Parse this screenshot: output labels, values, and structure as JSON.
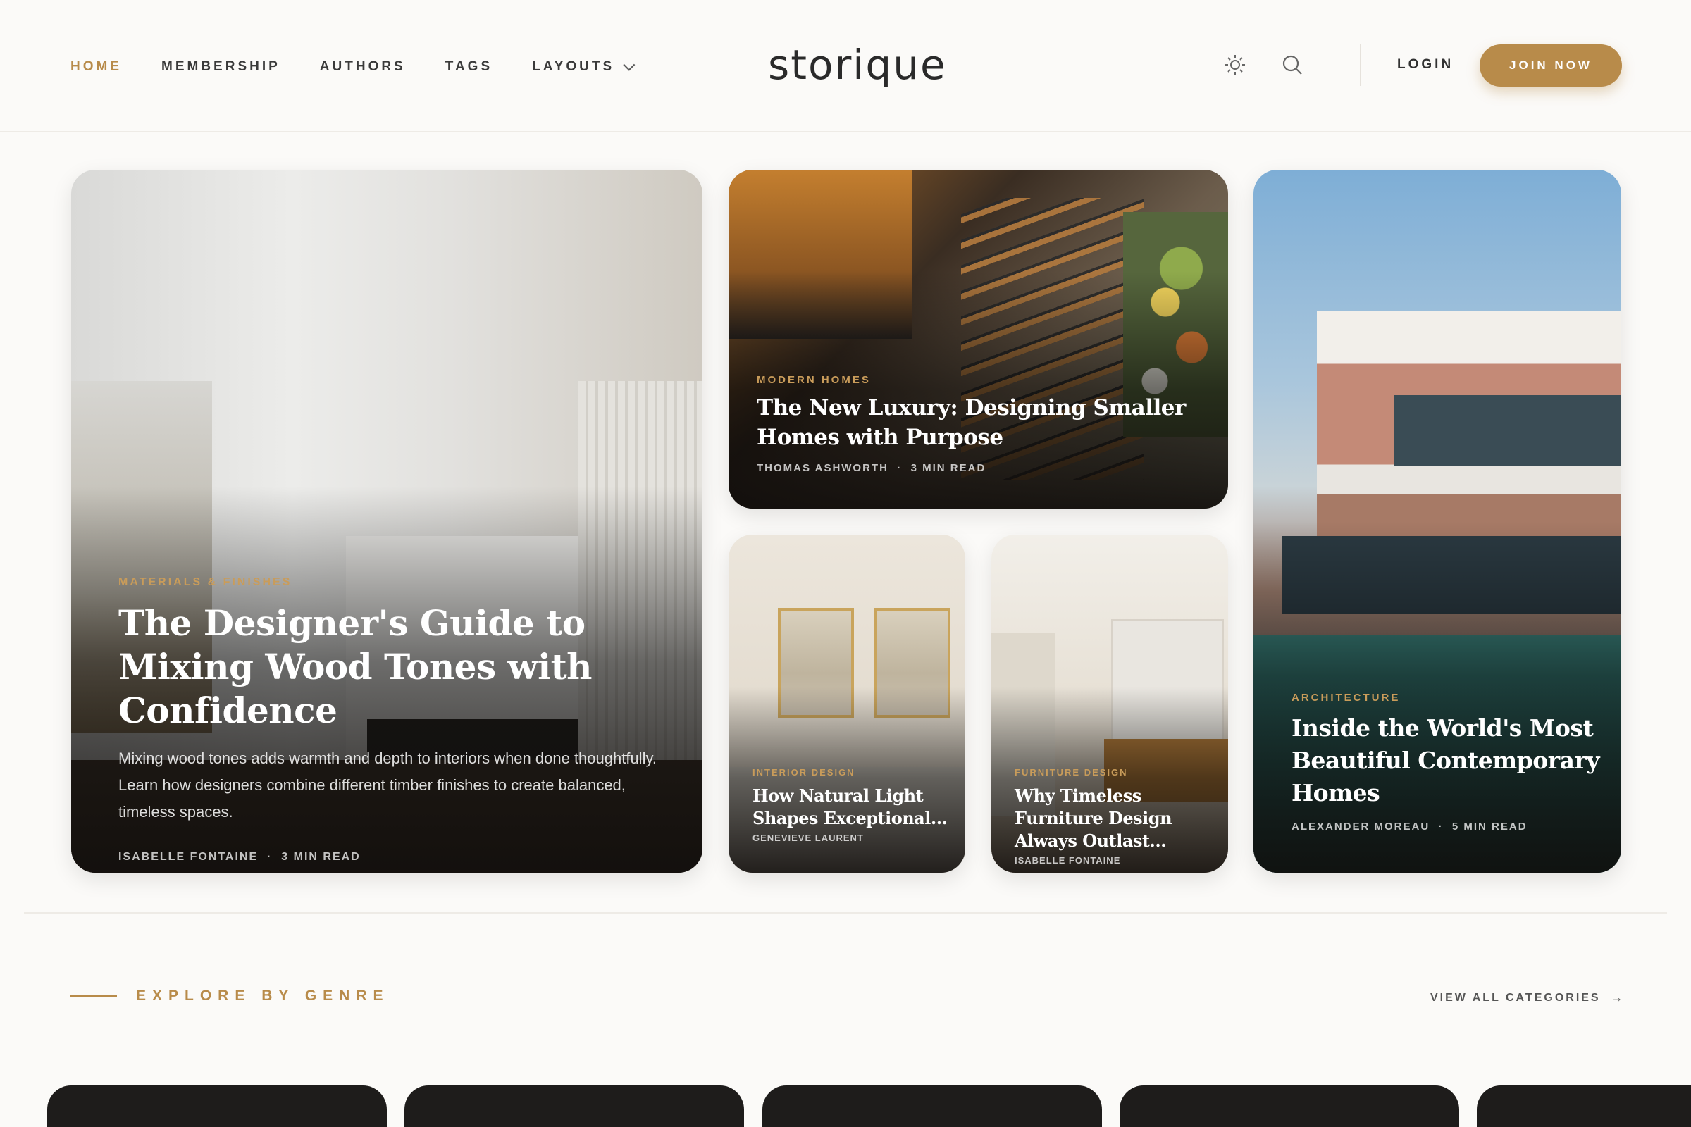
{
  "header": {
    "nav": [
      {
        "label": "HOME",
        "active": true
      },
      {
        "label": "MEMBERSHIP",
        "active": false
      },
      {
        "label": "AUTHORS",
        "active": false
      },
      {
        "label": "TAGS",
        "active": false
      },
      {
        "label": "LAYOUTS",
        "active": false
      }
    ],
    "logo": "storique",
    "icons": [
      "sun-icon",
      "search-icon"
    ],
    "login": "LOGIN",
    "join": "JOIN NOW"
  },
  "colors": {
    "accent": "#b88b4a",
    "background": "#fbfaf8",
    "text": "#2b2b2b"
  },
  "featured": [
    {
      "category": "MATERIALS & FINISHES",
      "title": "The Designer's Guide to Mixing Wood Tones with Confidence",
      "excerpt": "Mixing wood tones adds warmth and depth to interiors when done thoughtfully. Learn how designers combine different timber finishes to create balanced, timeless spaces.",
      "author": "ISABELLE FONTAINE",
      "read": "3 MIN READ"
    },
    {
      "category": "MODERN HOMES",
      "title": "The New Luxury: Designing Smaller Homes with Purpose",
      "author": "THOMAS ASHWORTH",
      "read": "3 MIN READ"
    },
    {
      "category": "INTERIOR DESIGN",
      "title": "How Natural Light Shapes Exceptional...",
      "author": "GENEVIEVE LAURENT"
    },
    {
      "category": "FURNITURE DESIGN",
      "title": "Why Timeless Furniture Design Always Outlast...",
      "author": "ISABELLE FONTAINE"
    },
    {
      "category": "ARCHITECTURE",
      "title": "Inside the World's Most Beautiful Contemporary Homes",
      "author": "ALEXANDER MOREAU",
      "read": "5 MIN READ"
    }
  ],
  "genre": {
    "title": "EXPLORE BY GENRE",
    "view_all": "VIEW ALL CATEGORIES",
    "arrow": "→"
  },
  "meta_sep": "·"
}
